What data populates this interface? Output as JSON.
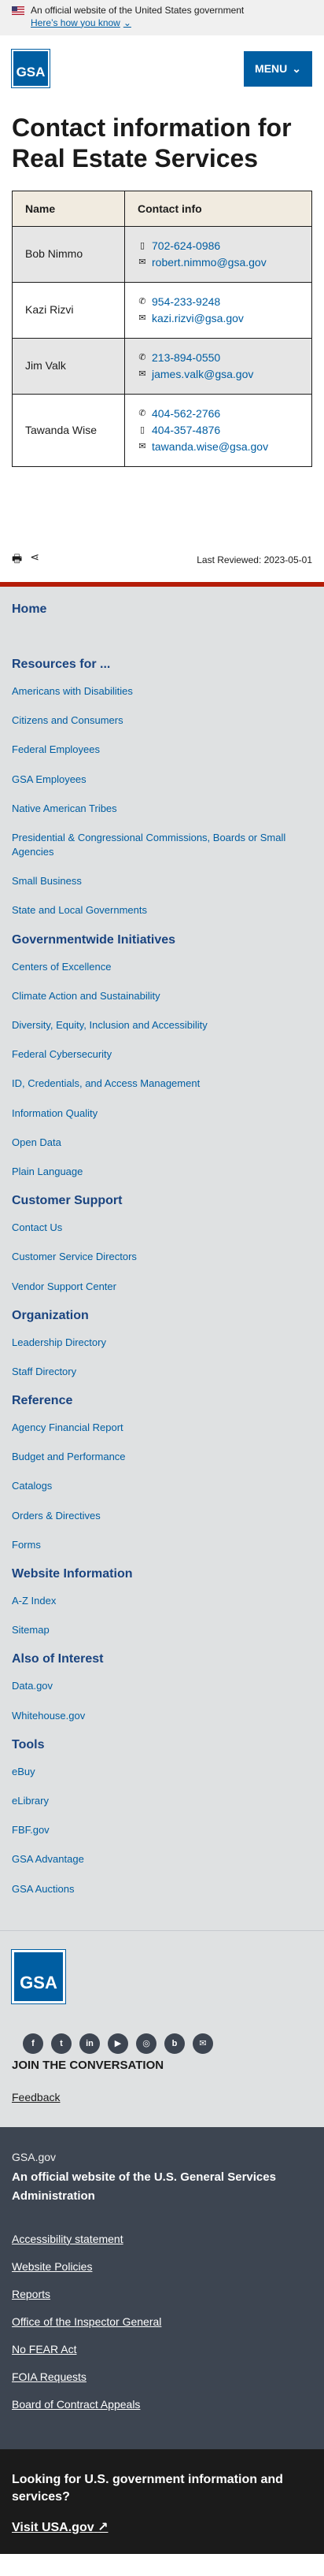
{
  "banner": {
    "text": "An official website of the United States government",
    "link": "Here’s how you know"
  },
  "header": {
    "logo_text": "GSA",
    "menu_label": "MENU"
  },
  "page_title": "Contact information for Real Estate Services",
  "table": {
    "headers": [
      "Name",
      "Contact info"
    ],
    "rows": [
      {
        "name": "Bob Nimmo",
        "items": [
          {
            "icon": "mobile-phone-icon",
            "text": "702-624-0986"
          },
          {
            "icon": "email-icon",
            "text": "robert.nimmo@gsa.gov"
          }
        ]
      },
      {
        "name": "Kazi Rizvi",
        "items": [
          {
            "icon": "phone-icon",
            "text": "954-233-9248"
          },
          {
            "icon": "email-icon",
            "text": "kazi.rizvi@gsa.gov"
          }
        ]
      },
      {
        "name": "Jim Valk",
        "items": [
          {
            "icon": "phone-icon",
            "text": "213-894-0550"
          },
          {
            "icon": "email-icon",
            "text": "james.valk@gsa.gov"
          }
        ]
      },
      {
        "name": "Tawanda Wise",
        "items": [
          {
            "icon": "phone-icon",
            "text": "404-562-2766"
          },
          {
            "icon": "mobile-phone-icon",
            "text": "404-357-4876"
          },
          {
            "icon": "email-icon",
            "text": "tawanda.wise@gsa.gov"
          }
        ]
      }
    ]
  },
  "review": {
    "text": "Last Reviewed: 2023-05-01"
  },
  "footer_nav": {
    "home": "Home",
    "sections": [
      {
        "title": "Resources for ...",
        "links": [
          "Americans with Disabilities",
          "Citizens and Consumers",
          "Federal Employees",
          "GSA Employees",
          "Native American Tribes",
          "Presidential & Congressional Commissions, Boards or Small Agencies",
          "Small Business",
          "State and Local Governments"
        ]
      },
      {
        "title": "Governmentwide Initiatives",
        "links": [
          "Centers of Excellence",
          "Climate Action and Sustainability",
          "Diversity, Equity, Inclusion and Accessibility",
          "Federal Cybersecurity",
          "ID, Credentials, and Access Management",
          "Information Quality",
          "Open Data",
          "Plain Language"
        ]
      },
      {
        "title": "Customer Support",
        "links": [
          "Contact Us",
          "Customer Service Directors",
          "Vendor Support Center"
        ]
      },
      {
        "title": "Organization",
        "links": [
          "Leadership Directory",
          "Staff Directory"
        ]
      },
      {
        "title": "Reference",
        "links": [
          "Agency Financial Report",
          "Budget and Performance",
          "Catalogs",
          "Orders & Directives",
          "Forms"
        ]
      },
      {
        "title": "Website Information",
        "links": [
          "A-Z Index",
          "Sitemap"
        ]
      },
      {
        "title": "Also of Interest",
        "links": [
          "Data.gov",
          "Whitehouse.gov"
        ]
      },
      {
        "title": "Tools",
        "links": [
          "eBuy",
          "eLibrary",
          "FBF.gov",
          "GSA Advantage",
          "GSA Auctions"
        ]
      }
    ]
  },
  "brand": {
    "logo_text": "GSA",
    "social_icons": [
      "facebook-icon",
      "twitter-icon",
      "linkedin-icon",
      "youtube-icon",
      "instagram-icon",
      "blog-icon",
      "email-icon"
    ],
    "join": "JOIN THE CONVERSATION",
    "feedback": "Feedback"
  },
  "identifier": {
    "domain": "GSA.gov",
    "official": "An official website of the U.S. General Services Administration",
    "links": [
      "Accessibility statement",
      "Website Policies",
      "Reports",
      "Office of the Inspector General",
      "No FEAR Act",
      "FOIA Requests",
      "Board of Contract Appeals"
    ]
  },
  "lookfor": {
    "text": "Looking for U.S. government information and services?",
    "link": "Visit USA.gov"
  }
}
